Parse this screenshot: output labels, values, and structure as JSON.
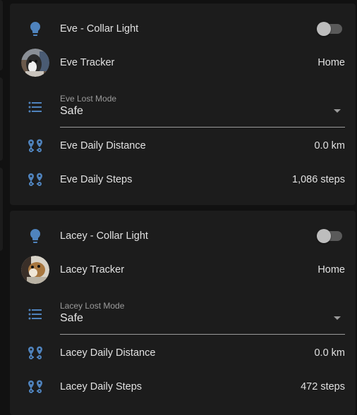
{
  "colors": {
    "background": "#111111",
    "card": "#1c1c1c",
    "icon_accent": "#4f83bd",
    "toggle_off_track": "#5a5a5a",
    "toggle_off_knob": "#bdbdbd"
  },
  "eve": {
    "collar_light": {
      "label": "Eve - Collar Light",
      "icon": "lightbulb-icon",
      "state": "off"
    },
    "tracker": {
      "label": "Eve Tracker",
      "value": "Home",
      "icon": "avatar"
    },
    "lost_mode": {
      "caption": "Eve Lost Mode",
      "value": "Safe",
      "icon": "list-icon"
    },
    "daily_distance": {
      "label": "Eve Daily Distance",
      "value": "0.0 km",
      "icon": "map-marker-path-icon"
    },
    "daily_steps": {
      "label": "Eve Daily Steps",
      "value": "1,086 steps",
      "icon": "map-marker-path-icon"
    }
  },
  "lacey": {
    "collar_light": {
      "label": "Lacey - Collar Light",
      "icon": "lightbulb-icon",
      "state": "off"
    },
    "tracker": {
      "label": "Lacey Tracker",
      "value": "Home",
      "icon": "avatar"
    },
    "lost_mode": {
      "caption": "Lacey Lost Mode",
      "value": "Safe",
      "icon": "list-icon"
    },
    "daily_distance": {
      "label": "Lacey Daily Distance",
      "value": "0.0 km",
      "icon": "map-marker-path-icon"
    },
    "daily_steps": {
      "label": "Lacey Daily Steps",
      "value": "472 steps",
      "icon": "map-marker-path-icon"
    }
  }
}
